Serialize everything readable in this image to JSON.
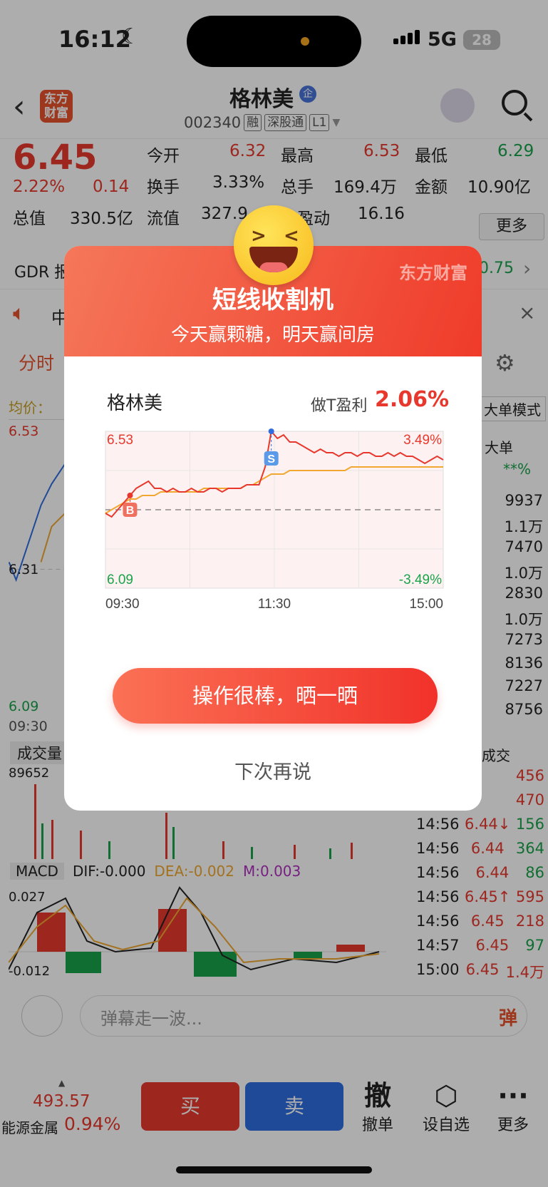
{
  "status": {
    "time": "16:12",
    "network": "5G",
    "battery": "28"
  },
  "header": {
    "logo": "东方财富",
    "title": "格林美",
    "qi": "企",
    "code": "002340",
    "tags": [
      "融",
      "深股通",
      "L1"
    ]
  },
  "quote": {
    "price": "6.45",
    "pct": "2.22%",
    "chg": "0.14",
    "open_label": "今开",
    "open": "6.32",
    "high_label": "最高",
    "high": "6.53",
    "low_label": "最低",
    "low": "6.29",
    "turnover_label": "换手",
    "turnover": "3.33%",
    "vol_label": "总手",
    "vol": "169.4万",
    "amount_label": "金额",
    "amount": "10.90亿",
    "cap_label": "总值",
    "cap": "330.5亿",
    "float_label": "流值",
    "float": "327.9",
    "pe_label": "市盈动",
    "pe": "16.16",
    "more": "更多"
  },
  "gdr": {
    "label": "GDR 报",
    "value": "0.75"
  },
  "news": {
    "label": "中"
  },
  "tabs": {
    "first": "分时"
  },
  "left_chart": {
    "avg_label": "均价：",
    "top": "6.53",
    "mid": "6.31",
    "bottom": "6.09",
    "start": "09:30",
    "vol_label": "成交量",
    "vol_max": "89652",
    "big_order": "大单",
    "mode": "大单模式",
    "pct_star": "**%"
  },
  "macd": {
    "name": "MACD",
    "dif": "DIF:-0.000",
    "dea": "DEA:-0.002",
    "m": "M:0.003",
    "max": "0.027",
    "min": "-0.012",
    "trades_label": "成交"
  },
  "right_values": [
    "9937",
    "1.1万",
    "7470",
    "1.0万",
    "2830",
    "1.0万",
    "7273",
    "8136",
    "7227",
    "8756"
  ],
  "trades": [
    {
      "time": "",
      "price": "",
      "vol": "456"
    },
    {
      "time": "",
      "price": "",
      "vol": "470"
    },
    {
      "time": "14:56",
      "price": "6.44↓",
      "vol": "156"
    },
    {
      "time": "14:56",
      "price": "6.44",
      "vol": "364"
    },
    {
      "time": "14:56",
      "price": "6.44",
      "vol": "86"
    },
    {
      "time": "14:56",
      "price": "6.45↑",
      "vol": "595"
    },
    {
      "time": "14:56",
      "price": "6.45",
      "vol": "218"
    },
    {
      "time": "14:57",
      "price": "6.45",
      "vol": "97"
    },
    {
      "time": "15:00",
      "price": "6.45",
      "vol": "1.4万"
    }
  ],
  "danmu": {
    "placeholder": "弹幕走一波...",
    "btn": "弹"
  },
  "bottom": {
    "index_value": "493.57",
    "index_name": "能源金属",
    "index_pct": "0.94%",
    "buy": "买",
    "sell": "卖",
    "cancel": "撤单",
    "cancel_glyph": "撤",
    "watch": "设自选",
    "more": "更多"
  },
  "modal": {
    "brand": "东方财富",
    "title": "短线收割机",
    "subtitle": "今天赢颗糖，明天赢间房",
    "stock": "格林美",
    "profit_label": "做T盈利",
    "profit": "2.06%",
    "share": "操作很棒，晒一晒",
    "later": "下次再说"
  },
  "chart_data": {
    "type": "line",
    "x_ticks": [
      "09:30",
      "11:30",
      "15:00"
    ],
    "y_top": "6.53",
    "y_bottom": "6.09",
    "pct_top": "3.49%",
    "pct_bottom": "-3.49%",
    "ylim": [
      6.09,
      6.53
    ],
    "prev_close": 6.31,
    "buy_marker": "B",
    "sell_marker": "S",
    "price": [
      6.3,
      6.29,
      6.31,
      6.33,
      6.35,
      6.37,
      6.38,
      6.39,
      6.37,
      6.37,
      6.36,
      6.37,
      6.36,
      6.36,
      6.37,
      6.36,
      6.36,
      6.37,
      6.37,
      6.36,
      6.37,
      6.37,
      6.37,
      6.38,
      6.38,
      6.38,
      6.43,
      6.53,
      6.51,
      6.52,
      6.5,
      6.5,
      6.49,
      6.48,
      6.47,
      6.48,
      6.47,
      6.47,
      6.46,
      6.47,
      6.47,
      6.46,
      6.47,
      6.47,
      6.46,
      6.46,
      6.47,
      6.46,
      6.47,
      6.46,
      6.46,
      6.45,
      6.44,
      6.45,
      6.46,
      6.45
    ],
    "avg": [
      6.3,
      6.31,
      6.32,
      6.33,
      6.34,
      6.34,
      6.35,
      6.35,
      6.35,
      6.36,
      6.36,
      6.36,
      6.36,
      6.36,
      6.36,
      6.36,
      6.37,
      6.37,
      6.37,
      6.37,
      6.37,
      6.37,
      6.37,
      6.38,
      6.38,
      6.39,
      6.4,
      6.41,
      6.41,
      6.41,
      6.42,
      6.42,
      6.42,
      6.42,
      6.42,
      6.42,
      6.42,
      6.42,
      6.42,
      6.42,
      6.43,
      6.43,
      6.43,
      6.43,
      6.43,
      6.43,
      6.43,
      6.43,
      6.43,
      6.43,
      6.43,
      6.43,
      6.43,
      6.43,
      6.43,
      6.43
    ],
    "buy_index": 4,
    "sell_index": 27
  },
  "colors": {
    "red": "#e8382d",
    "green": "#1aa34a",
    "blue": "#2f6de0",
    "accent": "#e8532d",
    "avg_line": "#f0a830"
  }
}
